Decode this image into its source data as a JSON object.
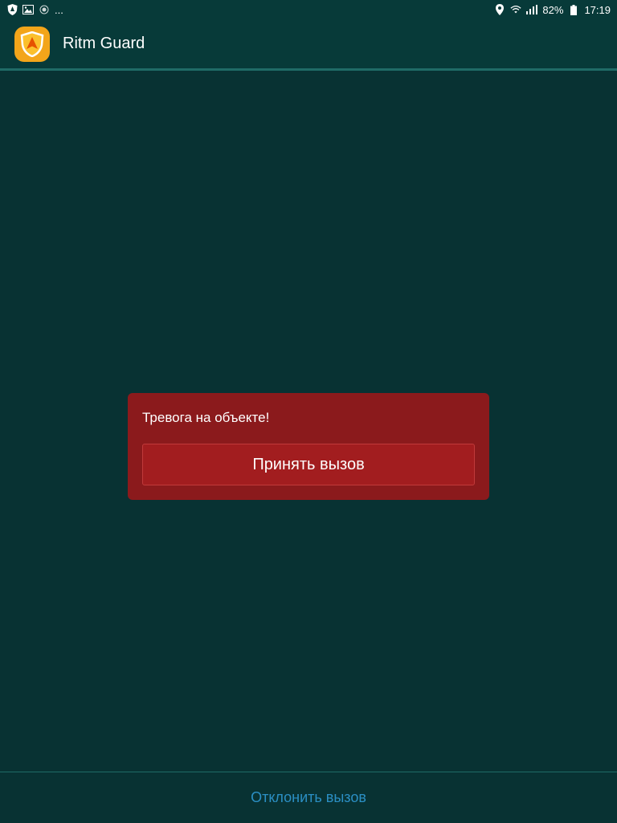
{
  "status_bar": {
    "left_icons": [
      "shield-icon",
      "image-icon",
      "record-icon"
    ],
    "more": "...",
    "battery_percent": "82%",
    "time": "17:19"
  },
  "app_bar": {
    "title": "Ritm Guard",
    "icon": "shield-icon",
    "icon_color": "#f3a51a"
  },
  "alarm": {
    "message": "Тревога на объекте!",
    "accept_label": "Принять вызов",
    "card_color": "#8b1a1c",
    "button_color": "#a21d1f"
  },
  "footer": {
    "decline_label": "Отклонить вызов",
    "decline_color": "#2b8fc4"
  }
}
